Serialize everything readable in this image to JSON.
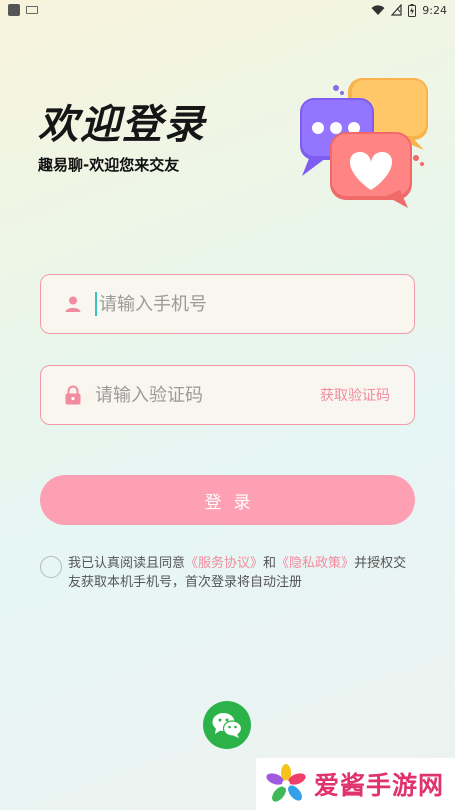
{
  "status_bar": {
    "time": "9:24",
    "left_icons": [
      "app-icon",
      "keyboard-icon"
    ],
    "right_icons": [
      "wifi-icon",
      "signal-icon",
      "battery-charging-icon"
    ]
  },
  "header": {
    "title": "欢迎登录",
    "subtitle": "趣易聊-欢迎您来交友",
    "illustration": "chat-bubbles-heart-illustration"
  },
  "form": {
    "phone_placeholder": "请输入手机号",
    "phone_value": "",
    "code_placeholder": "请输入验证码",
    "code_value": "",
    "get_code_label": "获取验证码",
    "login_label": "登录"
  },
  "agreement": {
    "checked": false,
    "prefix": "我已认真阅读且同意",
    "service_link": "《服务协议》",
    "and": "和",
    "privacy_link": "《隐私政策》",
    "suffix": "并授权交友获取本机手机号，首次登录将自动注册"
  },
  "social_login": {
    "icon": "wechat-icon"
  },
  "watermark": {
    "text": "爱酱手游网"
  },
  "colors": {
    "accent_pink": "#f38ba0",
    "button_pink": "#fda0b3",
    "field_border": "#f29aa8",
    "cursor_teal": "#39c4c4",
    "wechat_green": "#2bb34a",
    "watermark_red": "#e0326e"
  }
}
